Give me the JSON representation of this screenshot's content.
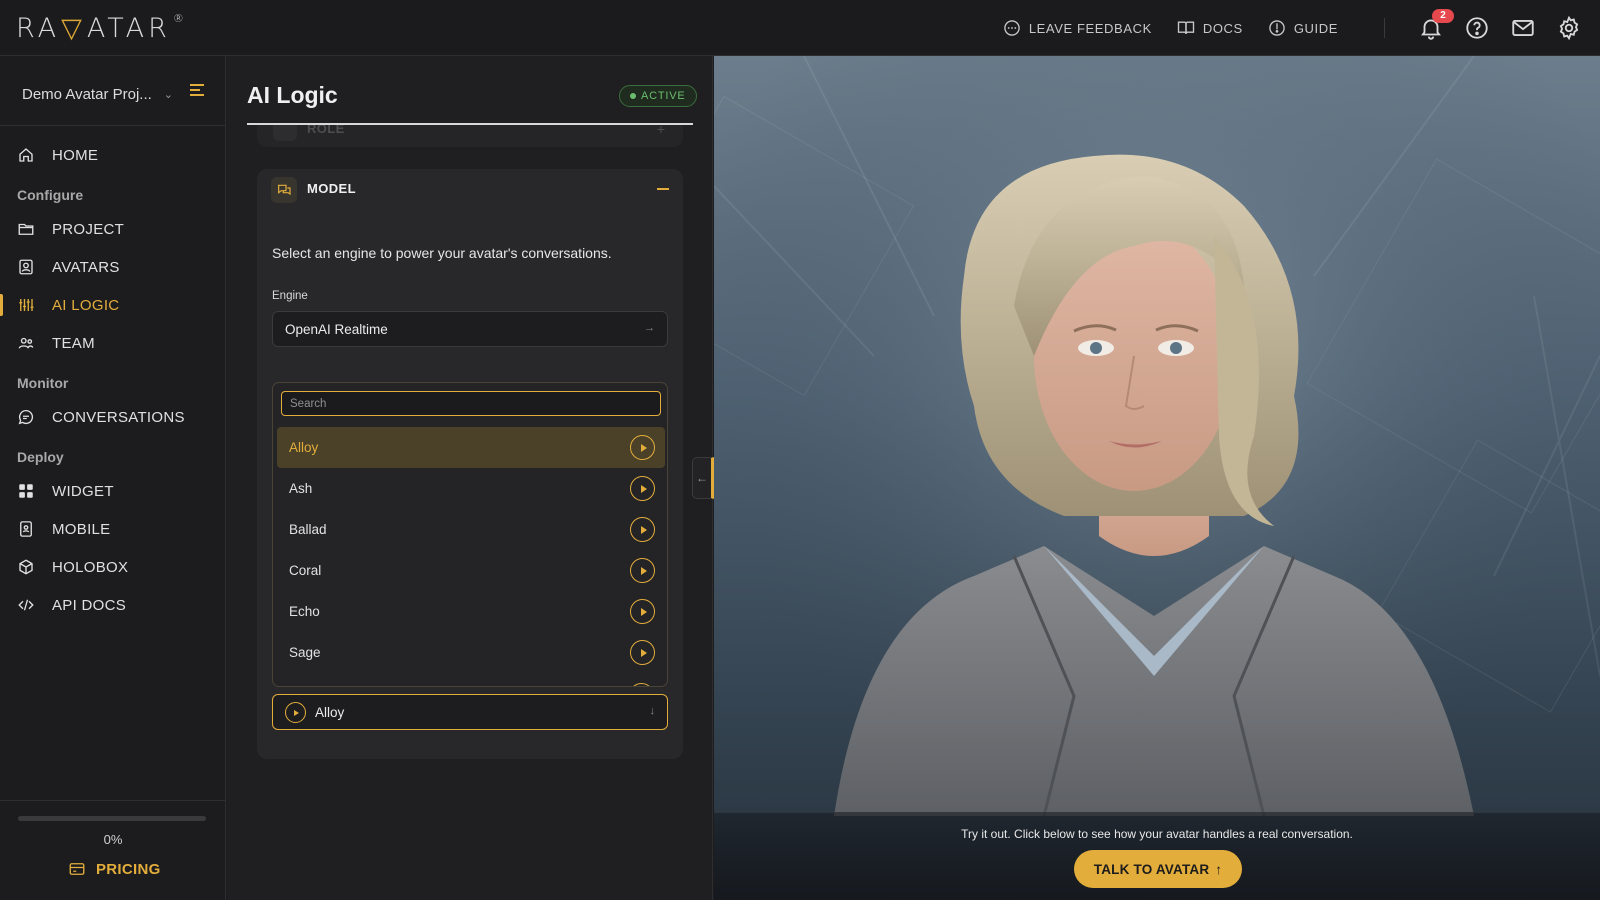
{
  "brand": {
    "logo_text": "RAVATAR",
    "reg": "®"
  },
  "topbar": {
    "links": [
      {
        "label": "LEAVE FEEDBACK",
        "icon": "chat-bubble-icon"
      },
      {
        "label": "DOCS",
        "icon": "book-icon"
      },
      {
        "label": "GUIDE",
        "icon": "compass-icon"
      }
    ],
    "notifications_count": "2",
    "icons": [
      "bell-icon",
      "help-icon",
      "mail-icon",
      "gear-icon"
    ]
  },
  "sidebar": {
    "project_name": "Demo Avatar Proj...",
    "home": "HOME",
    "groups": {
      "configure": "Configure",
      "monitor": "Monitor",
      "deploy": "Deploy"
    },
    "items": {
      "project": "PROJECT",
      "avatars": "AVATARS",
      "ai_logic": "AI LOGIC",
      "team": "TEAM",
      "conversations": "CONVERSATIONS",
      "widget": "WIDGET",
      "mobile": "MOBILE",
      "holobox": "HOLOBOX",
      "api_docs": "API DOCS"
    },
    "active_item": "ai_logic",
    "progress": {
      "value": 0,
      "label": "0%"
    },
    "pricing": "PRICING"
  },
  "panel": {
    "title": "AI Logic",
    "status": "ACTIVE",
    "role_section": "ROLE",
    "model_section": "MODEL",
    "description": "Select an engine to power your avatar's conversations.",
    "engine_label": "Engine",
    "engine_value": "OpenAI Realtime",
    "voice_search_placeholder": "Search",
    "voices": [
      "Alloy",
      "Ash",
      "Ballad",
      "Coral",
      "Echo",
      "Sage"
    ],
    "selected_voice": "Alloy"
  },
  "preview": {
    "hint": "Try it out. Click below to see how your avatar handles a real conversation.",
    "talk_button": "TALK TO AVATAR",
    "talk_arrow": "↑"
  },
  "colors": {
    "accent": "#e3ad3c",
    "status_green": "#6bbd6d",
    "notification_red": "#e5484d"
  }
}
